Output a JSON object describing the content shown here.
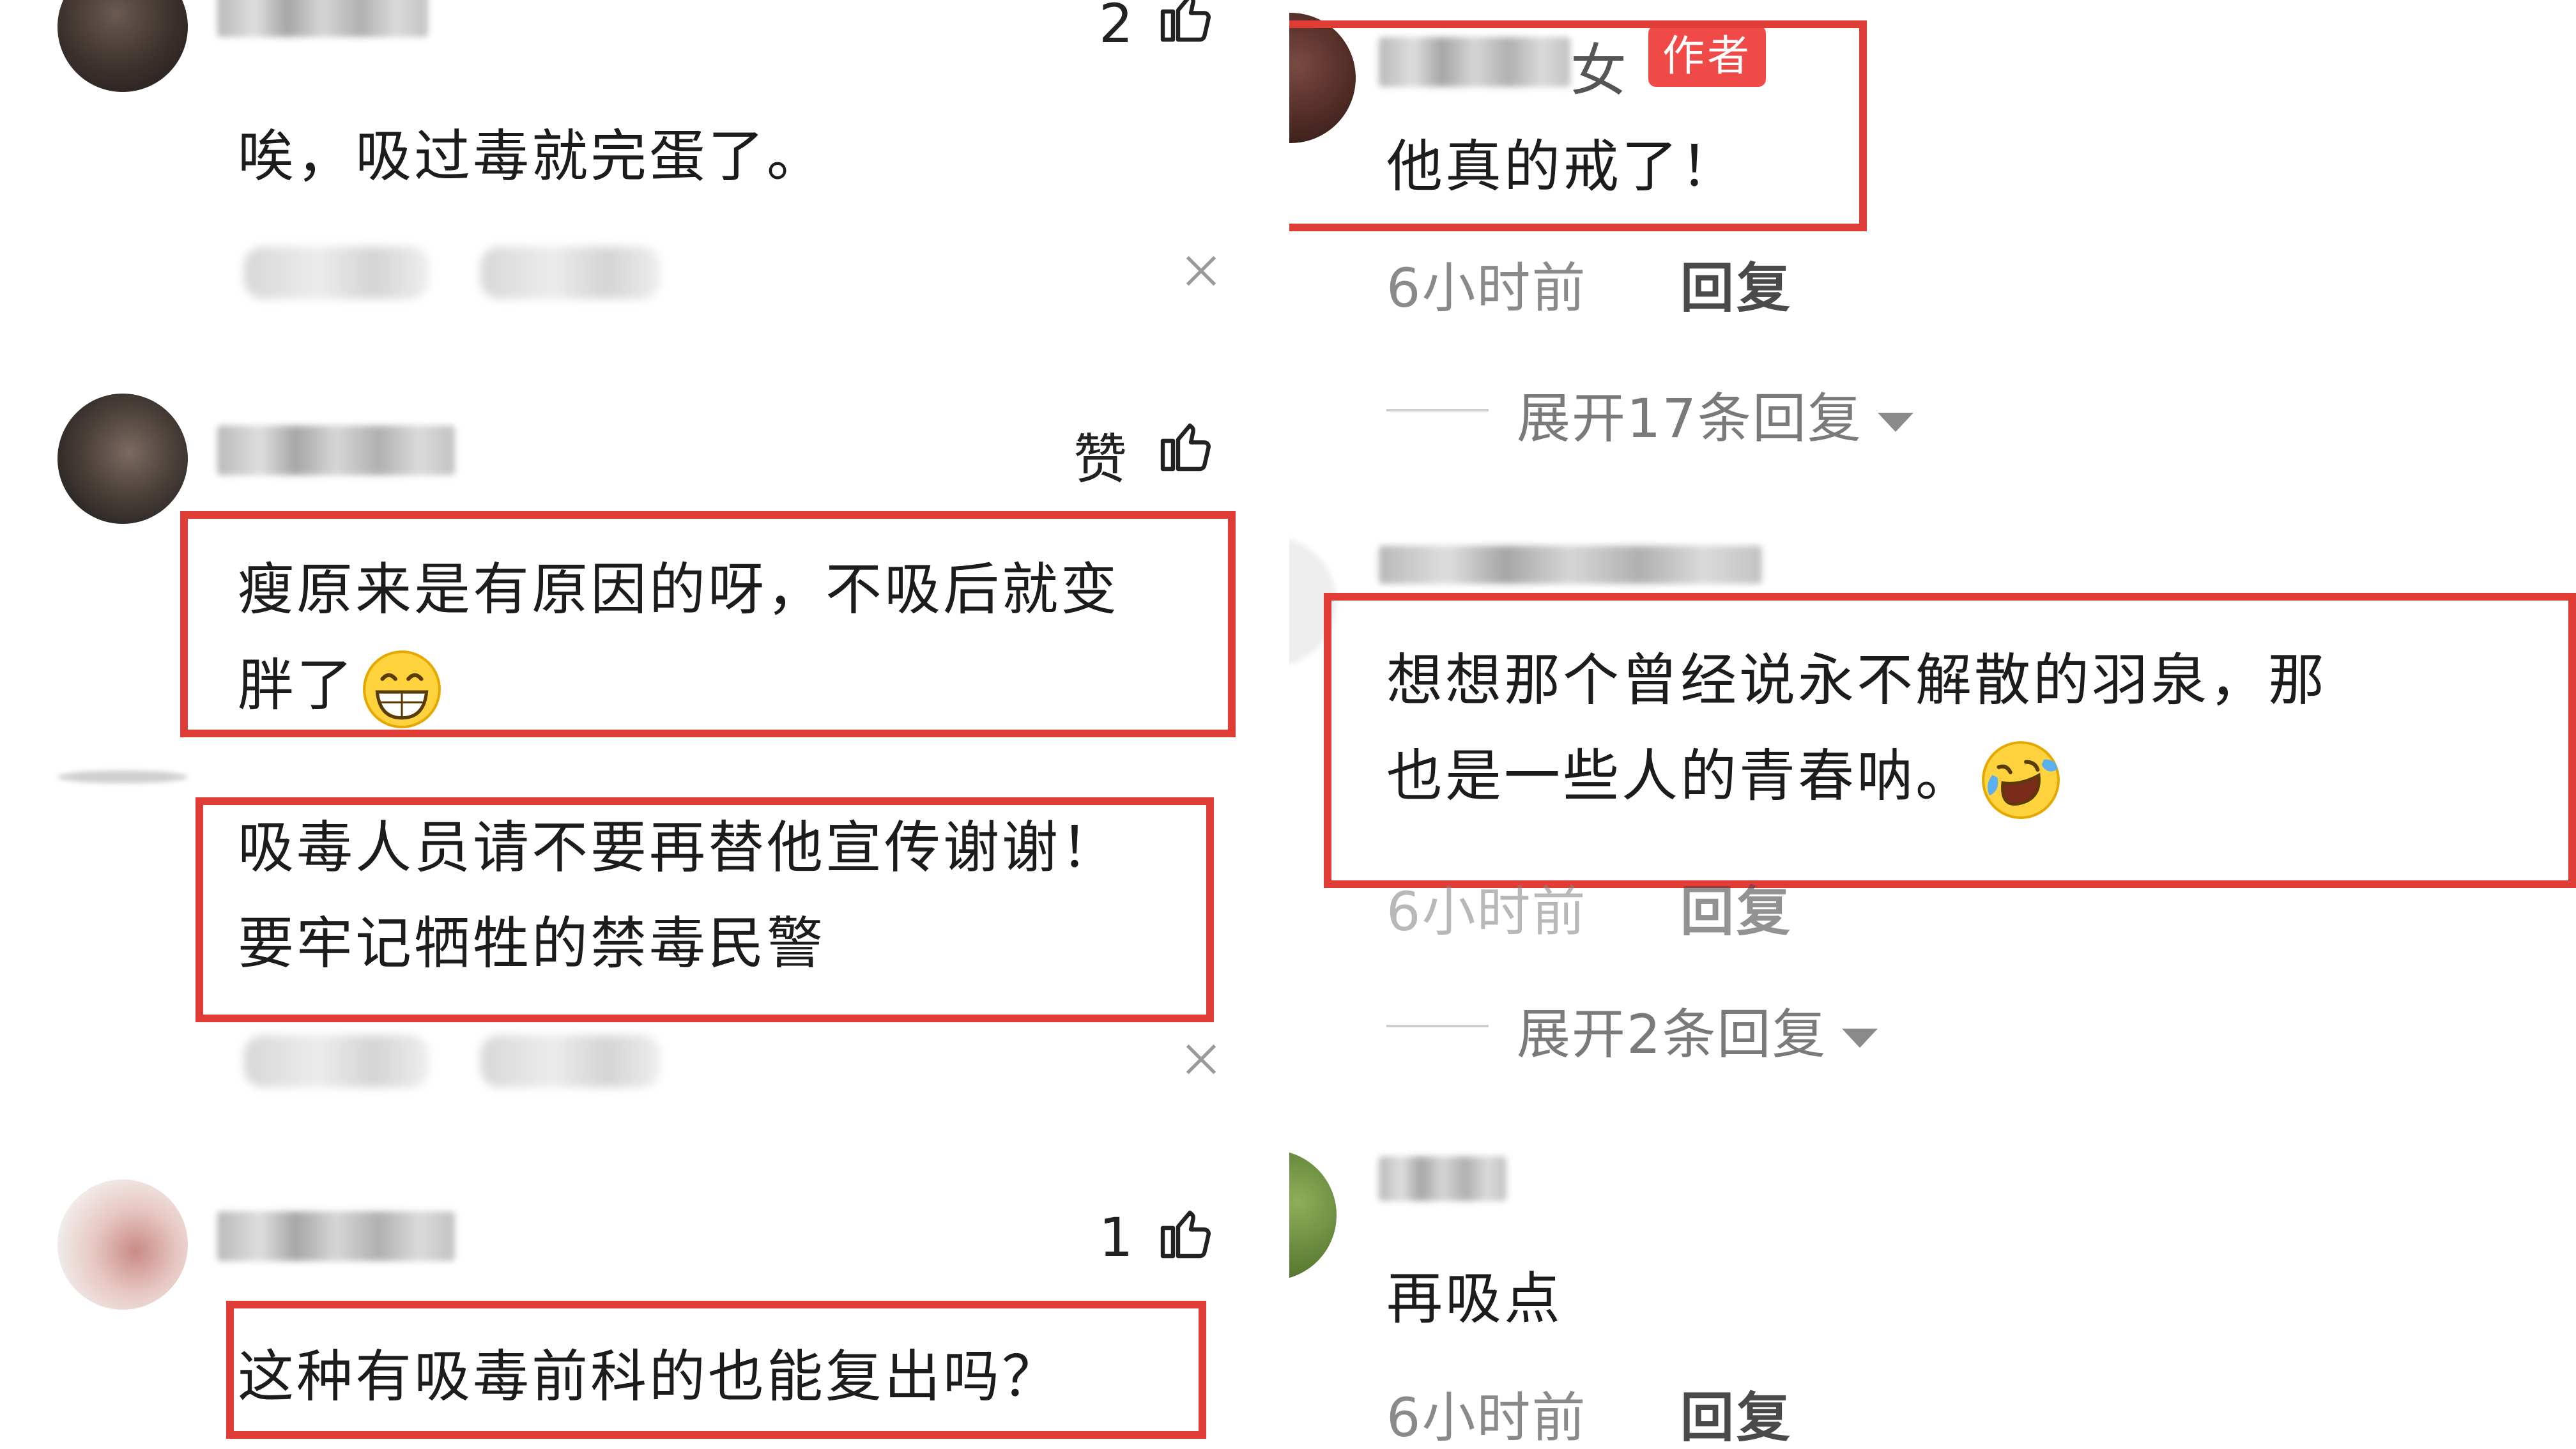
{
  "colors": {
    "highlight": "#e03c36",
    "author_badge": "#f04a48",
    "meta_text": "#8a8a8a"
  },
  "left": {
    "c1": {
      "text": "唉，吸过毒就完蛋了。",
      "like_count": "2"
    },
    "c2": {
      "line1": "瘦原来是有原因的呀，不吸后就变",
      "line2": "胖了",
      "like_label": "赞",
      "emoji": "grinning-face"
    },
    "c3": {
      "line1": "吸毒人员请不要再替他宣传谢谢！",
      "line2": "要牢记牺牲的禁毒民警"
    },
    "c4": {
      "text": "这种有吸毒前科的也能复出吗？",
      "like_count": "1"
    }
  },
  "right": {
    "author": {
      "name_visible": "女",
      "badge": "作者",
      "text": "他真的戒了！",
      "time": "6小时前",
      "reply": "回复",
      "expand": "展开17条回复"
    },
    "c2": {
      "line1": "想想那个曾经说永不解散的羽泉，那",
      "line2": "也是一些人的青春呐。",
      "time": "6小时前",
      "reply": "回复",
      "expand": "展开2条回复",
      "emoji": "rolling-on-floor-laughing"
    },
    "c3": {
      "text": "再吸点",
      "time": "6小时前",
      "reply": "回复"
    }
  }
}
